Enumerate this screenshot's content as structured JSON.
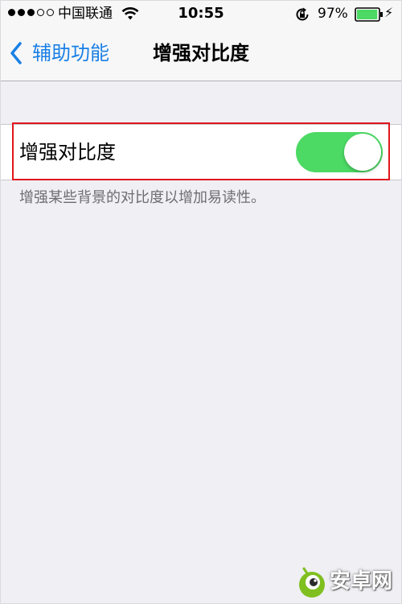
{
  "status_bar": {
    "carrier": "中国联通",
    "time": "10:55",
    "battery_percent": "97%",
    "signal_bars_filled": 3,
    "signal_bars_total": 5,
    "battery_level": 0.97
  },
  "nav": {
    "back_label": "辅助功能",
    "title": "增强对比度"
  },
  "setting": {
    "label": "增强对比度",
    "enabled": true,
    "footer": "增强某些背景的对比度以增加易读性。"
  },
  "watermark": {
    "text": "安卓网"
  },
  "colors": {
    "accent": "#1a80e5",
    "toggle_on": "#4cd964",
    "highlight": "#e0171d",
    "background": "#efeff4"
  },
  "icons": {
    "wifi": "wifi-icon",
    "rotation_lock": "rotation-lock-icon",
    "battery": "battery-icon",
    "charging": "charging-icon",
    "back": "chevron-left-icon"
  }
}
